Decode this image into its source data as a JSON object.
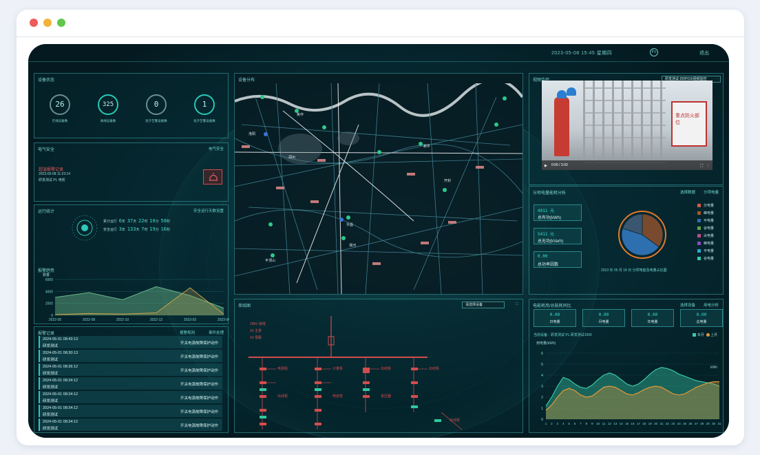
{
  "window": {
    "dots": [
      "#ee5b5b",
      "#f2b33b",
      "#5fc74a"
    ]
  },
  "topbar": {
    "date": "2023-05-08 15:45 星期四",
    "logout": "退出",
    "bell": "Fn"
  },
  "device_status": {
    "title": "设备状态",
    "items": [
      {
        "value": "26",
        "label": "在线设备数"
      },
      {
        "value": "325",
        "label": "离线设备数"
      },
      {
        "value": "0",
        "label": "处于告警设备数"
      },
      {
        "value": "1",
        "label": "处于告警设备数"
      }
    ]
  },
  "electric_safety": {
    "title": "电气安全",
    "link": "电气安全",
    "alarm_title": "超温报警记录",
    "alarm_time": "2023-05-08 11:23:14",
    "alarm_device": "研发测试 PL 电柜"
  },
  "operation_stats": {
    "title": "运行统计",
    "link": "安全运行天数设置",
    "row1": {
      "label": "累计运行",
      "years": "6",
      "y_unit": "年",
      "days": "37",
      "d_unit": "天",
      "hours": "22",
      "h_unit": "时",
      "mins": "10",
      "m_unit": "分",
      "secs": "58",
      "s_unit": "秒"
    },
    "row2": {
      "label": "安全运行",
      "years": "3",
      "y_unit": "年",
      "days": "133",
      "d_unit": "天",
      "hours": "7",
      "h_unit": "时",
      "mins": "19",
      "m_unit": "分",
      "secs": "16",
      "s_unit": "秒"
    }
  },
  "alarm_trend": {
    "title": "报警趋势",
    "ylabel": "数量",
    "chart_data": {
      "type": "area",
      "categories": [
        "2022-05",
        "2022-08",
        "2022-10",
        "2022-12",
        "2023-02",
        "2023-04"
      ],
      "series": [
        {
          "values": [
            300,
            380,
            260,
            480,
            330,
            120
          ],
          "color": "#6bb58a"
        },
        {
          "values": [
            10,
            30,
            20,
            40,
            460,
            20
          ],
          "color": "#c9a24a"
        }
      ],
      "yticks": [
        "6000",
        "4000",
        "2000",
        "0"
      ],
      "ylim": [
        0,
        600
      ]
    }
  },
  "alarm_records": {
    "title": "报警记录",
    "link1": "报警规则",
    "link2": "事件处理",
    "rows": [
      {
        "time": "2024-05-01 08:43:13",
        "name": "研发测试",
        "type": "开关电源故障保护动作"
      },
      {
        "time": "2024-05-01 08:30:13",
        "name": "研发测试",
        "type": "开关电源故障保护动作"
      },
      {
        "time": "2024-05-01 08:36:12",
        "name": "研发测试",
        "type": "开关电源故障保护动作"
      },
      {
        "time": "2024-05-01 08:34:12",
        "name": "研发测试",
        "type": "开关电源故障保护动作"
      },
      {
        "time": "2024-05-01 08:34:12",
        "name": "研发测试",
        "type": "开关电源故障保护动作"
      },
      {
        "time": "2024-05-01 08:34:12",
        "name": "研发测试",
        "type": "开关电源故障保护动作"
      },
      {
        "time": "2024-05-01 08:34:12",
        "name": "研发测试",
        "type": "开关电源故障保护动作"
      }
    ]
  },
  "map": {
    "title": "设备分布",
    "labels": [
      "郑州",
      "开封",
      "新乡",
      "焦作",
      "洛阳",
      "许昌",
      "漯河",
      "平顶山"
    ]
  },
  "video": {
    "title": "视频监控",
    "select": "研发测试-DRP016视频监控",
    "time": "0:00 / 3:03",
    "sign": "重点防火部位"
  },
  "power_distribution": {
    "title": "分项电量能耗分析",
    "link1": "选择数据",
    "link2": "分项电量",
    "stats": [
      {
        "value": "4911 元",
        "label": "总有功(kWh)"
      },
      {
        "value": "5411 元",
        "label": "总无功(kVarh)"
      },
      {
        "value": "0.00",
        "label": "总功率因数"
      }
    ],
    "caption": "2023 年 05 月 18 日 分项电能及电量占比图",
    "legend": [
      {
        "name": "分电量",
        "color": "#d35a4b"
      },
      {
        "name": "峰电量",
        "color": "#a35a2c"
      },
      {
        "name": "平电量",
        "color": "#2e6fb0"
      },
      {
        "name": "谷电量",
        "color": "#5fa24c"
      },
      {
        "name": "尖电量",
        "color": "#c14b8a"
      },
      {
        "name": "峰电量",
        "color": "#8a4bc1"
      },
      {
        "name": "平电量",
        "color": "#2aa8c9"
      },
      {
        "name": "谷电量",
        "color": "#36c9a5"
      }
    ],
    "chart_data": {
      "type": "pie",
      "values": [
        35,
        45,
        20
      ],
      "colors": [
        "#7a4a2e",
        "#2e6fb0",
        "#3a5670"
      ]
    }
  },
  "single_line": {
    "title": "单线图",
    "select": "请选择设备",
    "source_labels": [
      "10kV 进线",
      "1# 主变",
      "1# 母联"
    ],
    "feeder_labels": [
      "电源柜",
      "计量柜",
      "出线柜",
      "出线柜",
      "出线柜",
      "电容柜",
      "变压器",
      "出线柜"
    ]
  },
  "energy_compare": {
    "title": "电能耗用/总能耗同比",
    "link1": "选择设备",
    "link2": "用电分析",
    "kpis": [
      {
        "value": "0.00",
        "label": "日电量"
      },
      {
        "value": "0.00",
        "label": "月电量"
      },
      {
        "value": "0.00",
        "label": "年电量"
      },
      {
        "value": "0.00",
        "label": "总电量"
      }
    ],
    "sub_title": "当前设备：研发测试 PL 研发测试1000",
    "legend": [
      {
        "name": "本月",
        "color": "#3ac7a5"
      },
      {
        "name": "上月",
        "color": "#e39a3a"
      }
    ],
    "ylabel": "用电量(kWh)",
    "unit": "kWh",
    "chart_data": {
      "type": "area",
      "x": [
        "1",
        "2",
        "3",
        "4",
        "5",
        "6",
        "7",
        "8",
        "9",
        "10",
        "11",
        "12",
        "13",
        "14",
        "15",
        "16",
        "17",
        "18",
        "19",
        "20",
        "21",
        "22",
        "23",
        "24",
        "25",
        "26",
        "27",
        "28",
        "29",
        "30",
        "31"
      ],
      "series": [
        {
          "name": "本月",
          "values": [
            1.2,
            2.0,
            3.0,
            3.8,
            3.6,
            3.2,
            2.9,
            2.8,
            3.1,
            3.6,
            4.0,
            4.2,
            4.0,
            3.6,
            3.2,
            3.0,
            3.2,
            3.6,
            4.1,
            4.5,
            4.7,
            4.6,
            4.4,
            4.1,
            3.9,
            3.7,
            3.5,
            3.4,
            3.3,
            3.2,
            3.0
          ],
          "color": "#3ac7a5"
        },
        {
          "name": "上月",
          "values": [
            0.8,
            1.3,
            2.0,
            2.6,
            2.8,
            2.6,
            2.2,
            2.0,
            2.1,
            2.5,
            2.9,
            3.0,
            2.9,
            2.6,
            2.3,
            2.2,
            2.4,
            2.7,
            2.9,
            3.0,
            2.9,
            2.6,
            2.3,
            2.2,
            2.3,
            2.6,
            2.9,
            3.1,
            3.3,
            3.4,
            3.4
          ],
          "color": "#e39a3a"
        }
      ],
      "yticks": [
        "6",
        "5",
        "4",
        "3",
        "2",
        "1",
        "0"
      ],
      "ylim": [
        0,
        6
      ]
    }
  }
}
